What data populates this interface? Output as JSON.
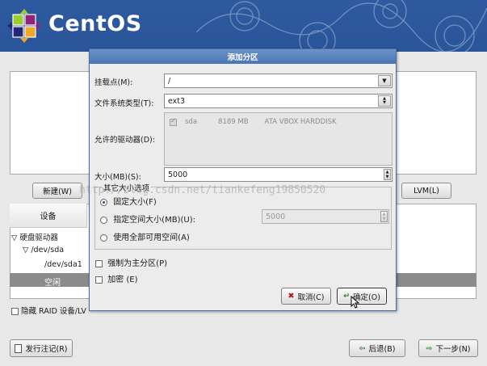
{
  "banner": {
    "brand": "CentOS"
  },
  "background": {
    "new_button": "新建(W)",
    "lvm_button": "LVM(L)",
    "device_header": "设备",
    "tree": {
      "hard_drives": "硬盘驱动器",
      "dev_sda": "/dev/sda",
      "dev_sda1": "/dev/sda1",
      "free": "空闲"
    },
    "hide_raid": "隐藏 RAID 设备/LV",
    "release_notes_button": "发行注记(R)",
    "back_button": "后退(B)",
    "next_button": "下一步(N)"
  },
  "dialog": {
    "title": "添加分区",
    "mount_point_label": "挂载点(M):",
    "mount_point_value": "/",
    "fs_type_label": "文件系统类型(T):",
    "fs_type_value": "ext3",
    "allowed_drives_label": "允许的驱动器(D):",
    "drive": {
      "name": "sda",
      "size": "8189 MB",
      "model": "ATA VBOX HARDDISK"
    },
    "size_label": "大小(MB)(S):",
    "size_value": "5000",
    "other_size_legend": "其它大小选项",
    "opt_fixed": "固定大小(F)",
    "opt_up_to": "指定空间大小(MB)(U):",
    "up_to_value": "5000",
    "opt_fill": "使用全部可用空间(A)",
    "force_primary": "强制为主分区(P)",
    "encrypt": "加密 (E)",
    "cancel_button": "取消(C)",
    "ok_button": "确定(O)"
  },
  "watermark": "http://blog.csdn.net/tiankefeng19850520"
}
